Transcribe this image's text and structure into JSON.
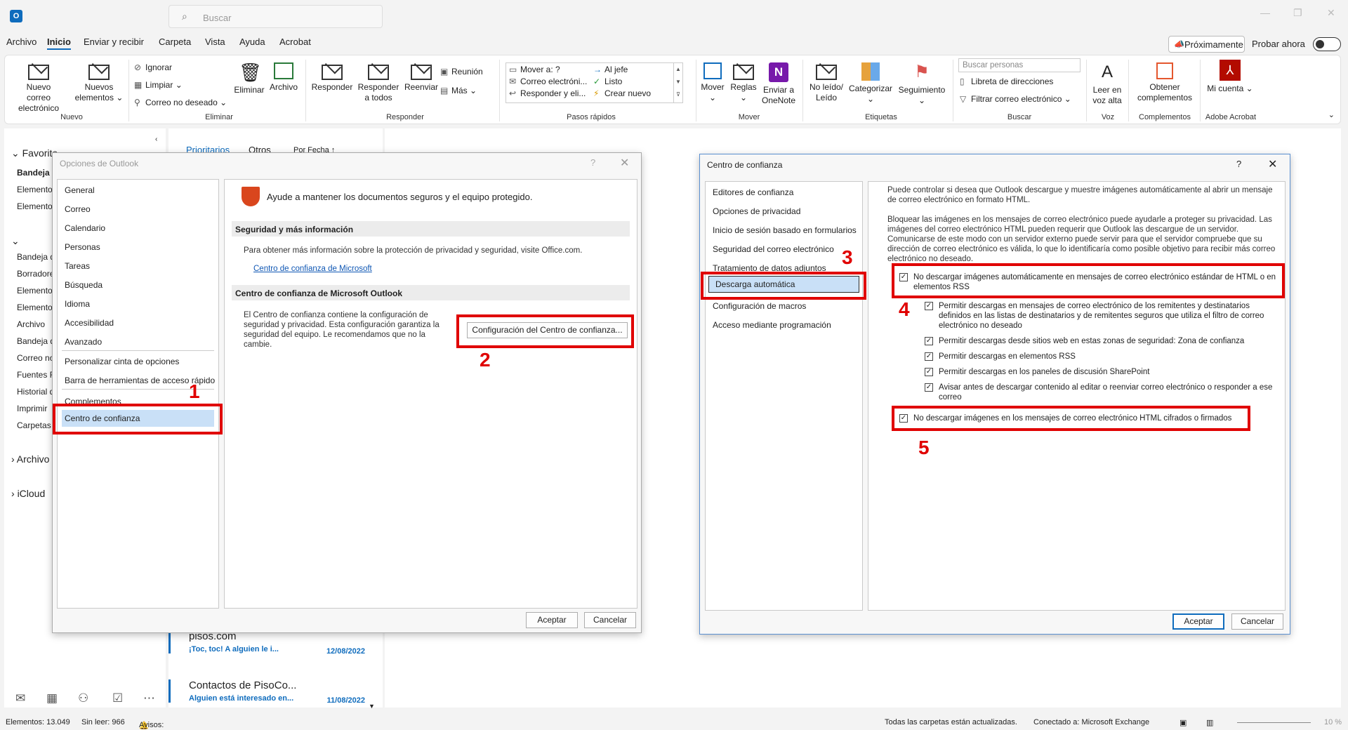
{
  "app": {
    "search_placeholder": "Buscar"
  },
  "menu": {
    "items": [
      "Archivo",
      "Inicio",
      "Enviar y recibir",
      "Carpeta",
      "Vista",
      "Ayuda",
      "Acrobat"
    ],
    "proximamente": "Próximamente",
    "probar_ahora": "Probar ahora"
  },
  "ribbon": {
    "nuevo_correo": "Nuevo correo electrónico",
    "nuevos_elementos": "Nuevos elementos",
    "ignorar": "Ignorar",
    "limpiar": "Limpiar",
    "correo_no_deseado": "Correo no deseado",
    "eliminar": "Eliminar",
    "archivo": "Archivo",
    "responder": "Responder",
    "responder_todos": "Responder a todos",
    "reenviar": "Reenviar",
    "reunion": "Reunión",
    "mas": "Más",
    "qs": [
      "Mover a: ?",
      "Correo electróni...",
      "Responder y eli...",
      "Al jefe",
      "Listo",
      "Crear nuevo"
    ],
    "mover": "Mover",
    "reglas": "Reglas",
    "enviar_onenote": "Enviar a OneNote",
    "no_leido": "No leído/ Leído",
    "categorizar": "Categorizar",
    "seguimiento": "Seguimiento",
    "buscar_personas": "Buscar personas",
    "libreta": "Libreta de direcciones",
    "filtrar": "Filtrar correo electrónico",
    "leer_voz": "Leer en voz alta",
    "obtener_complementos": "Obtener complementos",
    "mi_cuenta": "Mi cuenta",
    "groups": [
      "Nuevo",
      "Eliminar",
      "Responder",
      "Pasos rápidos",
      "Mover",
      "Etiquetas",
      "Buscar",
      "Voz",
      "Complementos",
      "Adobe Acrobat"
    ]
  },
  "nav": {
    "favoritos": "Favorito",
    "fav_items": [
      "Bandeja d",
      "Elemento",
      "Elemento"
    ],
    "folders": [
      "Bandeja d",
      "Borradore",
      "Elemento",
      "Elemento",
      "Archivo",
      "Bandeja d",
      "Correo no",
      "Fuentes R",
      "Historial d",
      "Imprimir",
      "Carpetas"
    ],
    "archivo": "Archivo",
    "icloud": "iCloud"
  },
  "list": {
    "tabs": [
      "Prioritarios",
      "Otros"
    ],
    "sort": "Por Fecha",
    "mails": [
      {
        "from": "pisos.com",
        "subject": "¡Toc, toc! A alguien le i...",
        "date": "12/08/2022"
      },
      {
        "from": "Contactos de PisoCo...",
        "subject": "Alguien está interesado en...",
        "date": "11/08/2022"
      }
    ]
  },
  "status": {
    "elementos": "Elementos: 13.049",
    "sin_leer": "Sin leer: 966",
    "avisos": "Avisos: 2",
    "actualizadas": "Todas las carpetas están actualizadas.",
    "conectado": "Conectado a: Microsoft Exchange",
    "zoom": "10 %"
  },
  "options_dialog": {
    "title": "Opciones de Outlook",
    "help": "?",
    "close": "✕",
    "categories": [
      "General",
      "Correo",
      "Calendario",
      "Personas",
      "Tareas",
      "Búsqueda",
      "Idioma",
      "Accesibilidad",
      "Avanzado",
      "Personalizar cinta de opciones",
      "Barra de herramientas de acceso rápido",
      "Complementos",
      "Centro de confianza"
    ],
    "header_text": "Ayude a mantener los documentos seguros y el equipo protegido.",
    "section1_title": "Seguridad y más información",
    "section1_text": "Para obtener más información sobre la protección de privacidad y seguridad, visite Office.com.",
    "section1_link": "Centro de confianza de Microsoft",
    "section2_title": "Centro de confianza de Microsoft Outlook",
    "section2_text": "El Centro de confianza contiene la configuración de seguridad y privacidad. Esta configuración garantiza la seguridad del equipo. Le recomendamos que no la cambie.",
    "settings_button": "Configuración del Centro de confianza...",
    "ok": "Aceptar",
    "cancel": "Cancelar"
  },
  "trust_dialog": {
    "title": "Centro de confianza",
    "help": "?",
    "close": "✕",
    "categories": [
      "Editores de confianza",
      "Opciones de privacidad",
      "Inicio de sesión basado en formularios",
      "Seguridad del correo electrónico",
      "Tratamiento de datos adjuntos",
      "Descarga automática",
      "Configuración de macros",
      "Acceso mediante programación"
    ],
    "intro1": "Puede controlar si desea que Outlook descargue y muestre imágenes automáticamente al abrir un mensaje de correo electrónico en formato HTML.",
    "intro2": "Bloquear las imágenes en los mensajes de correo electrónico puede ayudarle a proteger su privacidad. Las imágenes del correo electrónico HTML pueden requerir que Outlook las descargue de un servidor. Comunicarse de este modo con un servidor externo puede servir para que el servidor compruebe que su dirección de correo electrónico es válida, lo que lo identificaría como posible objetivo para recibir más correo electrónico no deseado.",
    "cb_main": "No descargar imágenes automáticamente en mensajes de correo electrónico estándar de HTML o en elementos RSS",
    "cb_subs": [
      "Permitir descargas en mensajes de correo electrónico de los remitentes y destinatarios definidos en las listas de destinatarios y de remitentes seguros que utiliza el filtro de correo electrónico no deseado",
      "Permitir descargas desde sitios web en estas zonas de seguridad: Zona de confianza",
      "Permitir descargas en elementos RSS",
      "Permitir descargas en los paneles de discusión SharePoint",
      "Avisar antes de descargar contenido al editar o reenviar correo electrónico o responder a ese correo"
    ],
    "cb_encrypted": "No descargar imágenes en los mensajes de correo electrónico HTML cifrados o firmados",
    "check": "✓",
    "ok": "Aceptar",
    "cancel": "Cancelar"
  },
  "annotations": [
    "1",
    "2",
    "3",
    "4",
    "5"
  ],
  "colors": {
    "accent": "#0f6cbd",
    "annotation": "#e00000",
    "selection": "#c9e0f7"
  }
}
